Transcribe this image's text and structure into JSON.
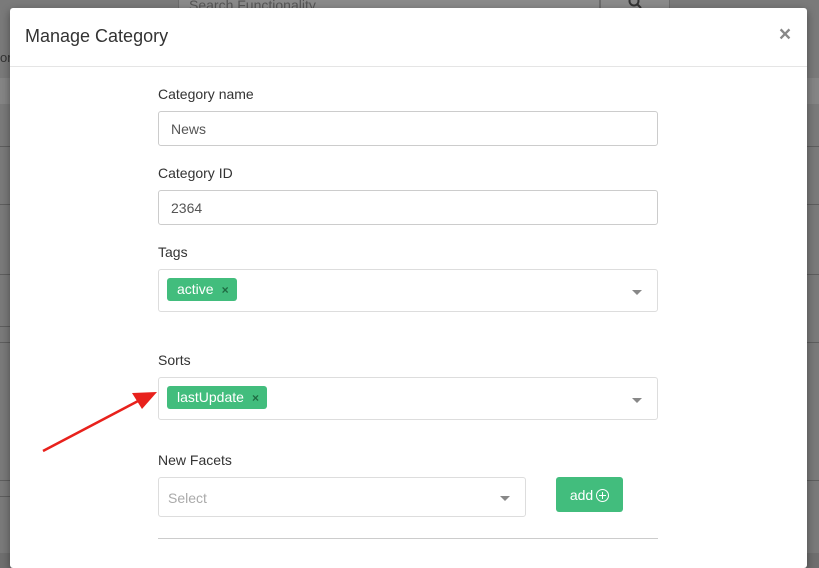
{
  "background": {
    "search_placeholder": "Search Functionality",
    "left_fragment": "or"
  },
  "modal": {
    "title": "Manage Category",
    "close_symbol": "×",
    "fields": {
      "category_name": {
        "label": "Category name",
        "value": "News"
      },
      "category_id": {
        "label": "Category ID",
        "value": "2364"
      },
      "tags": {
        "label": "Tags",
        "selected": [
          "active"
        ]
      },
      "sorts": {
        "label": "Sorts",
        "selected": [
          "lastUpdate"
        ]
      },
      "new_facets": {
        "label": "New Facets",
        "placeholder": "Select",
        "add_label": "add"
      }
    },
    "tag_remove_symbol": "×"
  },
  "colors": {
    "accent_green": "#42bd7d",
    "annotation_arrow": "#e8211c"
  }
}
